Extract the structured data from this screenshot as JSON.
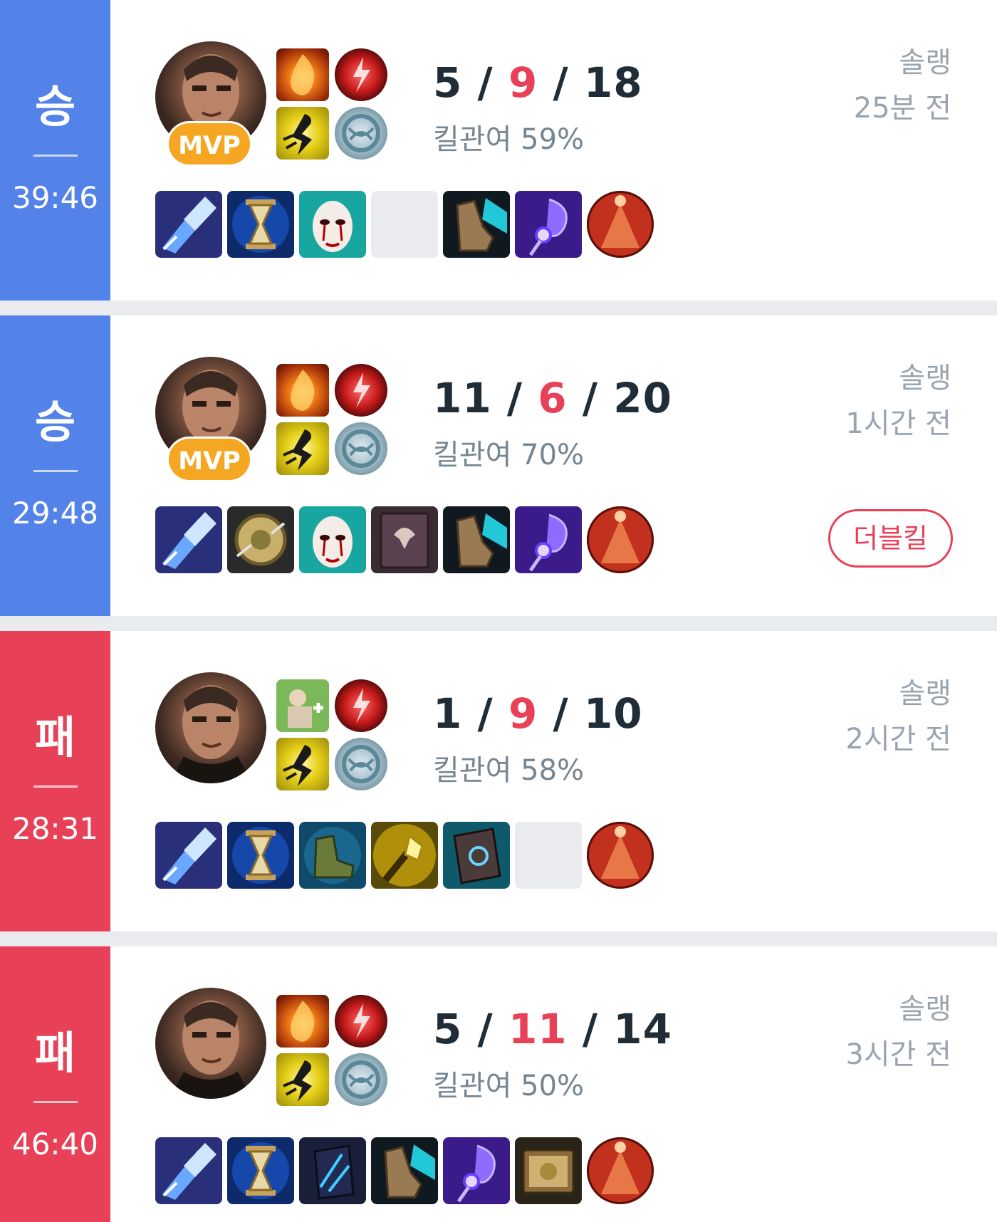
{
  "matches": [
    {
      "result": "승",
      "result_type": "win",
      "duration": "39:46",
      "champion_icon": "swain-portrait-icon",
      "mvp": "MVP",
      "spells": [
        "ignite-icon",
        "flash-icon"
      ],
      "runes": [
        "electrocute-rune-icon",
        "sorcery-rune-icon"
      ],
      "kda": {
        "kills": "5",
        "deaths": "9",
        "assists": "18"
      },
      "kill_participation": "킬관여 59%",
      "items": [
        "crystal-scepter-icon",
        "zhonyas-hourglass-icon",
        "liandrys-mask-icon",
        "empty",
        "sorcerers-shoes-icon",
        "rylais-staff-icon",
        "oracle-lens-icon"
      ],
      "queue": "솔랭",
      "time_ago": "25분 전",
      "multikill": ""
    },
    {
      "result": "승",
      "result_type": "win",
      "duration": "29:48",
      "champion_icon": "swain-portrait-icon",
      "mvp": "MVP",
      "spells": [
        "ignite-icon",
        "flash-icon"
      ],
      "runes": [
        "electrocute-rune-icon",
        "sorcery-rune-icon"
      ],
      "kda": {
        "kills": "11",
        "deaths": "6",
        "assists": "20"
      },
      "kill_participation": "킬관여 70%",
      "items": [
        "crystal-scepter-icon",
        "mercury-treads-icon",
        "liandrys-mask-icon",
        "demonic-tome-icon",
        "sorcerers-shoes-icon",
        "rylais-staff-icon",
        "oracle-lens-icon"
      ],
      "queue": "솔랭",
      "time_ago": "1시간 전",
      "multikill": "더블킬"
    },
    {
      "result": "패",
      "result_type": "loss",
      "duration": "28:31",
      "champion_icon": "swain-portrait-icon",
      "mvp": "",
      "spells": [
        "heal-icon",
        "flash-icon"
      ],
      "runes": [
        "electrocute-rune-icon",
        "sorcery-rune-icon"
      ],
      "kda": {
        "kills": "1",
        "deaths": "9",
        "assists": "10"
      },
      "kill_participation": "킬관여 58%",
      "items": [
        "crystal-scepter-icon",
        "zhonyas-hourglass-icon",
        "boots-icon",
        "hextech-wand-icon",
        "fiendish-codex-icon",
        "empty",
        "oracle-lens-icon"
      ],
      "queue": "솔랭",
      "time_ago": "2시간 전",
      "multikill": ""
    },
    {
      "result": "패",
      "result_type": "loss",
      "duration": "46:40",
      "champion_icon": "swain-portrait-icon",
      "mvp": "",
      "spells": [
        "ignite-icon",
        "flash-icon"
      ],
      "runes": [
        "electrocute-rune-icon",
        "sorcery-rune-icon"
      ],
      "kda": {
        "kills": "5",
        "deaths": "11",
        "assists": "14"
      },
      "kill_participation": "킬관여 50%",
      "items": [
        "crystal-scepter-icon",
        "zhonyas-hourglass-icon",
        "void-staff-icon",
        "sorcerers-shoes-icon",
        "rylais-staff-icon",
        "rabadons-tome-icon",
        "oracle-lens-icon"
      ],
      "queue": "솔랭",
      "time_ago": "3시간 전",
      "multikill": ""
    }
  ],
  "colors": {
    "win": "#5383e8",
    "loss": "#e84057",
    "death": "#e84057",
    "mvp": "#f5a623"
  }
}
